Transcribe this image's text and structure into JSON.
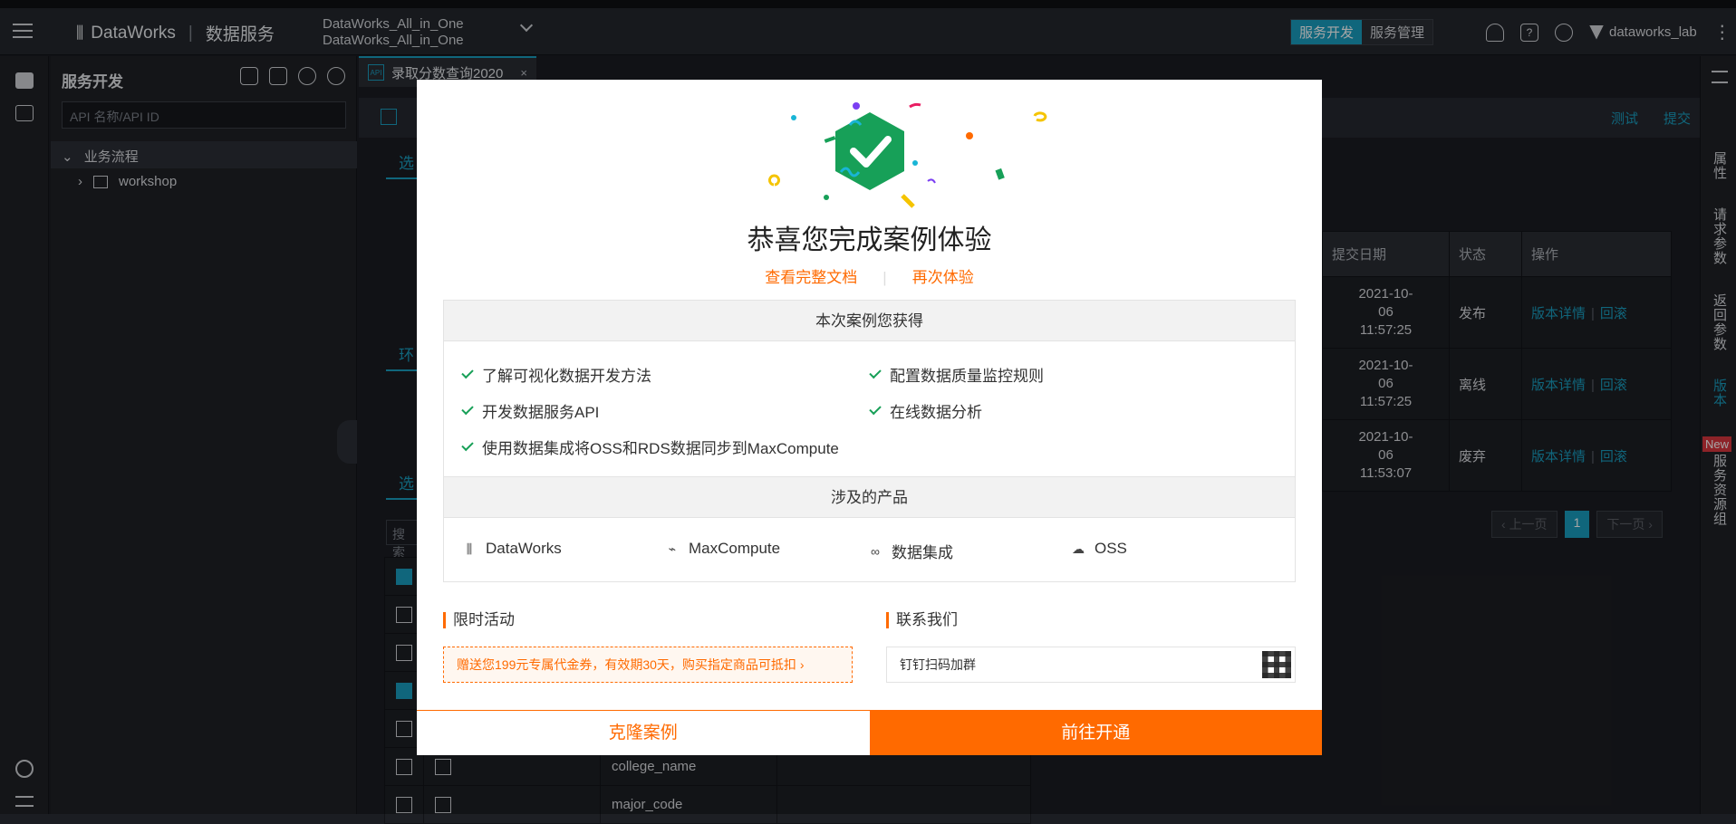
{
  "topbar": {
    "brand": "DataWorks",
    "service": "数据服务",
    "project_line1": "DataWorks_All_in_One",
    "project_line2": "DataWorks_All_in_One",
    "mode_dev": "服务开发",
    "mode_manage": "服务管理",
    "user": "dataworks_lab"
  },
  "sidebar": {
    "title": "服务开发",
    "search_placeholder": "API 名称/API ID",
    "tree_root": "业务流程",
    "tree_child": "workshop"
  },
  "editor": {
    "tab_label": "录取分数查询2020",
    "tab_api_badge": "API",
    "toolbar_test": "测试",
    "toolbar_submit": "提交",
    "section_select_1": "选",
    "section_env": "环",
    "section_select_2": "选",
    "search_stub": "搜索"
  },
  "versions": {
    "headers": [
      "提交日期",
      "状态",
      "操作"
    ],
    "rows": [
      {
        "date1": "2021-10-",
        "date2": "06",
        "date3": "11:57:25",
        "status": "发布",
        "detail": "版本详情",
        "rollback": "回滚"
      },
      {
        "date1": "2021-10-",
        "date2": "06",
        "date3": "11:57:25",
        "status": "离线",
        "detail": "版本详情",
        "rollback": "回滚"
      },
      {
        "date1": "2021-10-",
        "date2": "06",
        "date3": "11:53:07",
        "status": "废弃",
        "detail": "版本详情",
        "rollback": "回滚"
      }
    ],
    "pager_prev": "上一页",
    "pager_current": "1",
    "pager_next": "下一页"
  },
  "right_panel": {
    "items": [
      "属性",
      "请求参数",
      "返回参数",
      "版本",
      "服务资源组"
    ],
    "new_badge": "New"
  },
  "params_table": {
    "rows": [
      "college_name",
      "major_code"
    ]
  },
  "modal": {
    "title": "恭喜您完成案例体验",
    "link_docs": "查看完整文档",
    "link_retry": "再次体验",
    "gains_header": "本次案例您获得",
    "gains": [
      "了解可视化数据开发方法",
      "配置数据质量监控规则",
      "开发数据服务API",
      "在线数据分析",
      "使用数据集成将OSS和RDS数据同步到MaxCompute"
    ],
    "products_header": "涉及的产品",
    "products": [
      "DataWorks",
      "MaxCompute",
      "数据集成",
      "OSS"
    ],
    "promo_title": "限时活动",
    "promo_text": "赠送您199元专属代金券，有效期30天，购买指定商品可抵扣",
    "contact_title": "联系我们",
    "contact_text": "钉钉扫码加群",
    "btn_clone": "克隆案例",
    "btn_go": "前往开通",
    "accent_color": "#ff6a00",
    "check_color": "#18a058",
    "badge_color": "#17a058"
  }
}
